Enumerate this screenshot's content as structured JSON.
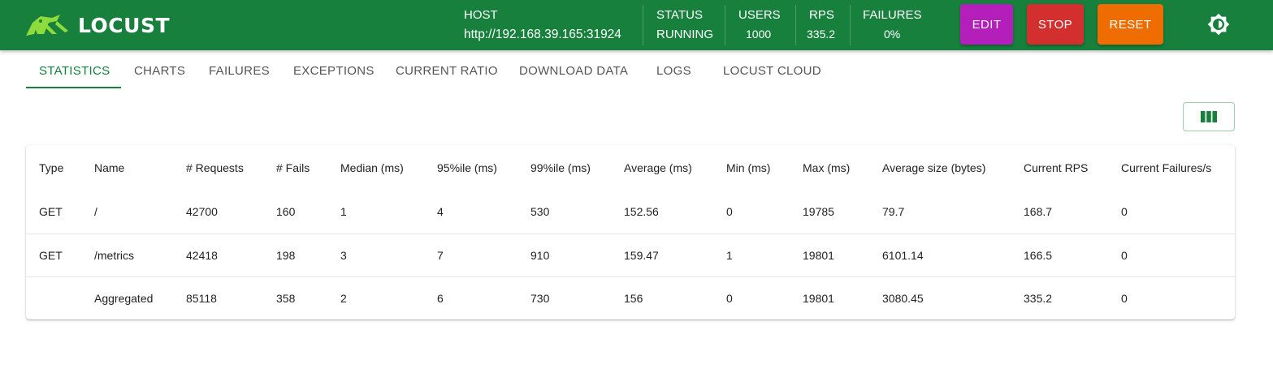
{
  "app": {
    "brand": "LOCUST"
  },
  "header": {
    "host_label": "HOST",
    "host_value": "http://192.168.39.165:31924",
    "status_label": "STATUS",
    "status_value": "RUNNING",
    "users_label": "USERS",
    "users_value": "1000",
    "rps_label": "RPS",
    "rps_value": "335.2",
    "failures_label": "FAILURES",
    "failures_value": "0%",
    "edit_label": "EDIT",
    "stop_label": "STOP",
    "reset_label": "RESET",
    "theme_icon": "brightness-icon"
  },
  "colors": {
    "primary": "#16803c",
    "edit": "#b41fbb",
    "stop": "#d32f2f",
    "reset": "#ef6c00",
    "logo_accent": "#8ddc3b"
  },
  "tabs": [
    {
      "label": "STATISTICS",
      "active": true
    },
    {
      "label": "CHARTS"
    },
    {
      "label": "FAILURES"
    },
    {
      "label": "EXCEPTIONS"
    },
    {
      "label": "CURRENT RATIO"
    },
    {
      "label": "DOWNLOAD DATA"
    },
    {
      "label": "LOGS"
    },
    {
      "label": "LOCUST CLOUD"
    }
  ],
  "toolbar": {
    "columns_icon": "view-columns-icon"
  },
  "table": {
    "columns": [
      "Type",
      "Name",
      "# Requests",
      "# Fails",
      "Median (ms)",
      "95%ile (ms)",
      "99%ile (ms)",
      "Average (ms)",
      "Min (ms)",
      "Max (ms)",
      "Average size (bytes)",
      "Current RPS",
      "Current Failures/s"
    ],
    "rows": [
      [
        "GET",
        "/",
        "42700",
        "160",
        "1",
        "4",
        "530",
        "152.56",
        "0",
        "19785",
        "79.7",
        "168.7",
        "0"
      ],
      [
        "GET",
        "/metrics",
        "42418",
        "198",
        "3",
        "7",
        "910",
        "159.47",
        "1",
        "19801",
        "6101.14",
        "166.5",
        "0"
      ],
      [
        "",
        "Aggregated",
        "85118",
        "358",
        "2",
        "6",
        "730",
        "156",
        "0",
        "19801",
        "3080.45",
        "335.2",
        "0"
      ]
    ]
  }
}
